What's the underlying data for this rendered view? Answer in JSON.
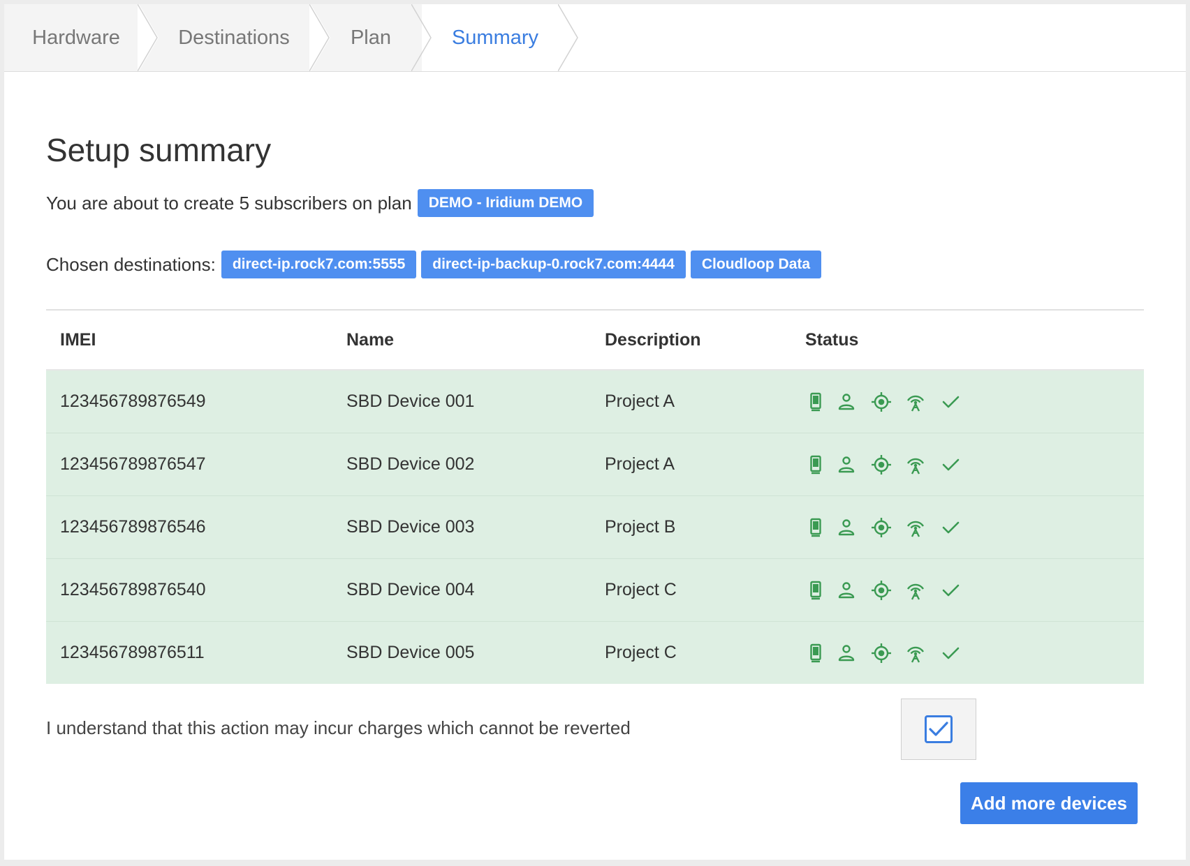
{
  "steps": [
    {
      "label": "Hardware",
      "state": "done"
    },
    {
      "label": "Destinations",
      "state": "done"
    },
    {
      "label": "Plan",
      "state": "done"
    },
    {
      "label": "Summary",
      "state": "active"
    }
  ],
  "summary": {
    "title": "Setup summary",
    "subscribers_text": "You are about to create 5 subscribers on plan",
    "plan_badge": "DEMO - Iridium DEMO",
    "destinations_label": "Chosen destinations:",
    "destinations": [
      "direct-ip.rock7.com:5555",
      "direct-ip-backup-0.rock7.com:4444",
      "Cloudloop Data"
    ]
  },
  "table": {
    "headers": {
      "imei": "IMEI",
      "name": "Name",
      "description": "Description",
      "status": "Status"
    },
    "rows": [
      {
        "imei": "123456789876549",
        "name": "SBD Device 001",
        "description": "Project A"
      },
      {
        "imei": "123456789876547",
        "name": "SBD Device 002",
        "description": "Project A"
      },
      {
        "imei": "123456789876546",
        "name": "SBD Device 003",
        "description": "Project B"
      },
      {
        "imei": "123456789876540",
        "name": "SBD Device 004",
        "description": "Project C"
      },
      {
        "imei": "123456789876511",
        "name": "SBD Device 005",
        "description": "Project C"
      }
    ],
    "status_icons": [
      "device-icon",
      "person-icon",
      "target-icon",
      "antenna-icon",
      "check-icon"
    ],
    "status_color": "#3a9a52",
    "row_background": "#deefe3"
  },
  "footer": {
    "agreement_text": "I understand that this action may incur charges which cannot be reverted",
    "agreement_checked": true,
    "add_button_label": "Add more devices"
  },
  "colors": {
    "accent": "#3a7de0",
    "badge": "#4f8ff0",
    "button": "#3b7fe8"
  }
}
